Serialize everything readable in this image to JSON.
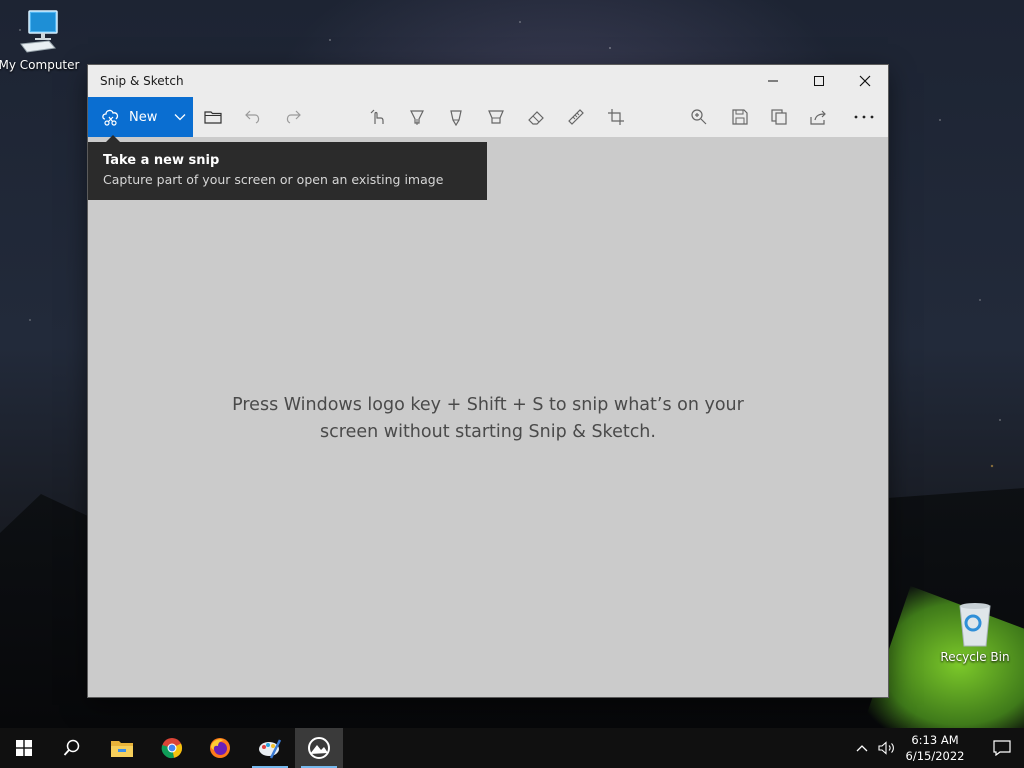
{
  "desktop": {
    "icons": [
      {
        "label": "My Computer"
      },
      {
        "label": "Recycle Bin"
      }
    ]
  },
  "window": {
    "title": "Snip & Sketch",
    "controls": [
      "minimize-icon",
      "maximize-icon",
      "close-icon"
    ],
    "toolbar": {
      "new_label": "New",
      "tools": [
        "open-file-icon",
        "undo-icon",
        "redo-icon",
        "touch-writing-icon",
        "ballpoint-pen-icon",
        "pencil-icon",
        "highlighter-icon",
        "eraser-icon",
        "ruler-icon",
        "crop-icon",
        "zoom-icon",
        "save-icon",
        "copy-icon",
        "share-icon",
        "more-icon"
      ]
    },
    "tooltip": {
      "title": "Take a new snip",
      "description": "Capture part of your screen or open an existing image"
    },
    "hint": "Press Windows logo key + Shift + S to snip what’s on your screen without starting Snip & Sketch."
  },
  "taskbar": {
    "apps": [
      "start-icon",
      "search-icon",
      "file-explorer-icon",
      "chrome-icon",
      "firefox-icon",
      "paint-icon",
      "snip-sketch-icon"
    ],
    "clock": {
      "time": "6:13 AM",
      "date": "6/15/2022"
    }
  },
  "colors": {
    "accent": "#0a6ed1",
    "tooltip_bg": "#2b2b2b",
    "canvas_bg": "#cbcbcb",
    "titlebar_bg": "#ececec",
    "taskbar_bg": "#101010"
  }
}
